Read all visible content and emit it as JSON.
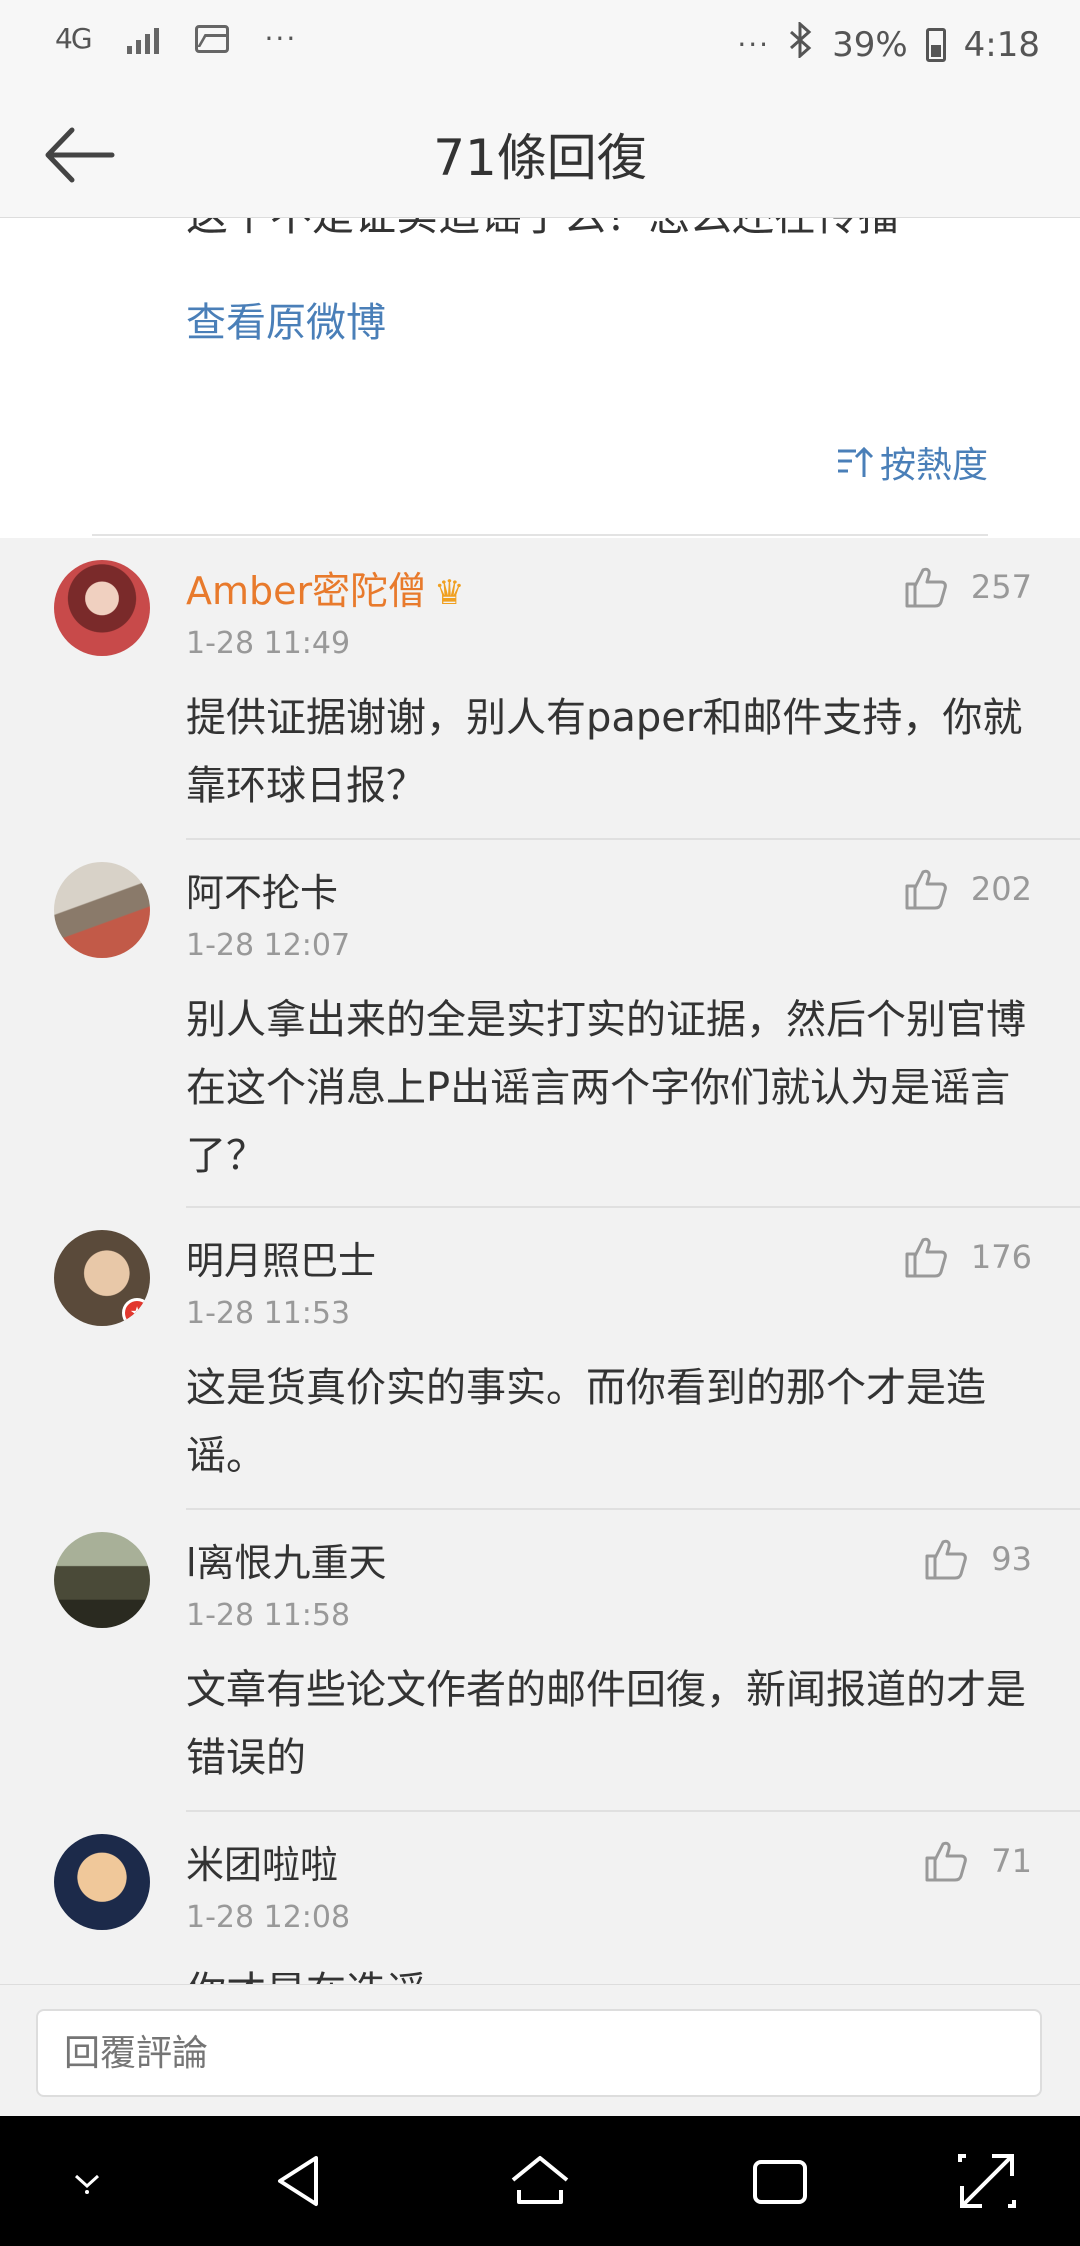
{
  "status_bar": {
    "network": "4G",
    "battery": "39%",
    "time": "4:18"
  },
  "header": {
    "title": "71條回復"
  },
  "post": {
    "text": "这个不是证实造谣了么？怎么还在传播",
    "view_original": "查看原微博",
    "sort_label": "按熱度"
  },
  "comments": [
    {
      "user": "Amber密陀僧",
      "vip": true,
      "time": "1-28 11:49",
      "likes": "257",
      "text": "提供证据谢谢，别人有paper和邮件支持，你就靠环球日报？"
    },
    {
      "user": "阿不抡卡",
      "vip": false,
      "time": "1-28 12:07",
      "likes": "202",
      "text": "别人拿出来的全是实打实的证据，然后个别官博在这个消息上P出谣言两个字你们就认为是谣言了？"
    },
    {
      "user": "明月照巴士",
      "vip": false,
      "time": "1-28 11:53",
      "likes": "176",
      "text": "这是货真价实的事实。而你看到的那个才是造谣。"
    },
    {
      "user": "l离恨九重天",
      "vip": false,
      "time": "1-28 11:58",
      "likes": "93",
      "text": "文章有些论文作者的邮件回復，新闻报道的才是错误的"
    },
    {
      "user": "米团啦啦",
      "vip": false,
      "time": "1-28 12:08",
      "likes": "71",
      "text": "你才是在造谣"
    }
  ],
  "reply": {
    "placeholder": "回覆評論"
  },
  "icons": {
    "back": "arrow-left-icon",
    "like": "thumbs-up-icon",
    "sort": "sort-icon",
    "nav": [
      "chevron-down-icon",
      "back-triangle-icon",
      "home-icon",
      "recents-icon",
      "expand-icon"
    ]
  },
  "colors": {
    "link": "#4a7fb8",
    "vip_name": "#e87a2c",
    "background": "#f2f2f2"
  }
}
